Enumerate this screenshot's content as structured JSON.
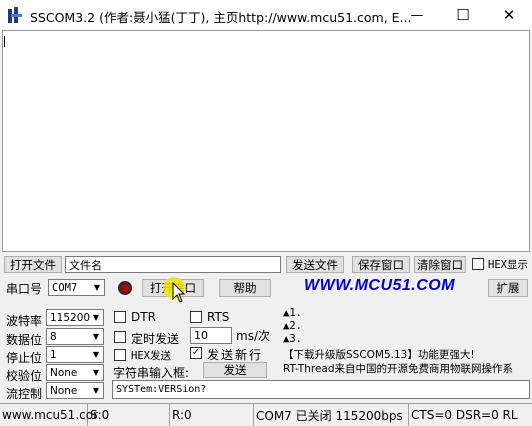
{
  "window": {
    "title": "SSCOM3.2 (作者:聂小猛(丁丁), 主页http://www.mcu51.com,  E...",
    "minimize": "—",
    "maximize": "☐",
    "close": "✕"
  },
  "toolbar": {
    "open_file": "打开文件",
    "filename": "文件名",
    "send_file": "发送文件",
    "save_window": "保存窗口",
    "clear_window": "清除窗口",
    "hex_display": "HEX显示"
  },
  "port_row": {
    "port_label": "串口号",
    "port_value": "COM7",
    "open_port": "打开串口",
    "help": "帮助",
    "website": "WWW.MCU51.COM",
    "expand": "扩展"
  },
  "settings": {
    "baud_label": "波特率",
    "baud_value": "115200",
    "databits_label": "数据位",
    "databits_value": "8",
    "stopbits_label": "停止位",
    "stopbits_value": "1",
    "parity_label": "校验位",
    "parity_value": "None",
    "flow_label": "流控制",
    "flow_value": "None"
  },
  "options": {
    "dtr": "DTR",
    "rts": "RTS",
    "timed_send": "定时发送",
    "interval_value": "10",
    "interval_unit": "ms/次",
    "hex_send": "HEX发送",
    "send_newline": "发送新行",
    "input_label": "字符串输入框:",
    "send": "发送",
    "input_value": "SYSTem:VERSion?"
  },
  "info": {
    "line1": "▲1.",
    "line2": "▲2.",
    "line3": "▲3.",
    "line4": "【下载升级版SSCOM5.13】功能更强大!",
    "line5": "RT-Thread来自中国的开源免费商用物联网操作系"
  },
  "statusbar": {
    "website": "www.mcu51.cor",
    "sent": "S:0",
    "received": "R:0",
    "port_status": "COM7 已关闭  115200bps",
    "signals": "CTS=0 DSR=0 RL"
  },
  "colors": {
    "accent": "#0000cc",
    "website_red": "#cc0000",
    "cursor_yellow": "#f5e600"
  }
}
